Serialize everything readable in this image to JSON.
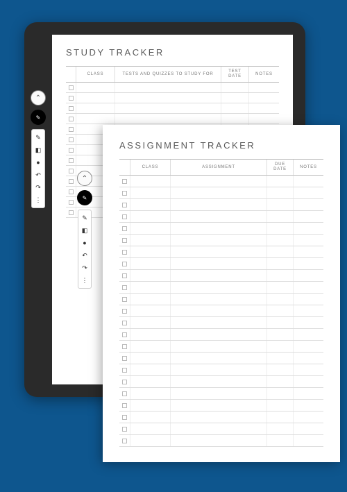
{
  "colors": {
    "background": "#0e568e",
    "tablet": "#2a2a2a",
    "paper": "#ffffff",
    "line": "#dddddd",
    "text_muted": "#777777"
  },
  "study_tracker": {
    "title": "STUDY TRACKER",
    "columns": {
      "class": "CLASS",
      "main": "TESTS AND QUIZZES\nTO STUDY FOR",
      "date": "TEST\nDATE",
      "notes": "NOTES"
    },
    "row_count": 13
  },
  "assignment_tracker": {
    "title": "ASSIGNMENT TRACKER",
    "columns": {
      "class": "CLASS",
      "main": "ASSIGNMENT",
      "date": "DUE\nDATE",
      "notes": "NOTES"
    },
    "row_count": 23
  },
  "toolbar": {
    "collapse_icon": "chevron-up",
    "active_tool": "pen",
    "tools": [
      "pen",
      "marker",
      "eraser",
      "undo",
      "redo",
      "more"
    ]
  }
}
